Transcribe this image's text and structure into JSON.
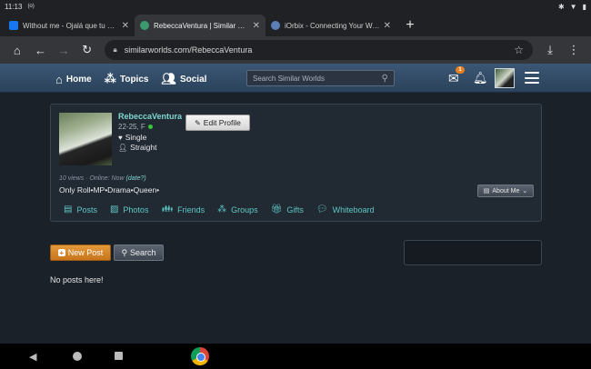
{
  "status_bar": {
    "time": "11:13",
    "extra": "(o)"
  },
  "tabs": [
    {
      "title": "Without me - Ojalá que tu vida esté llena de éxito",
      "favicon_color": "#1877f2",
      "active": false
    },
    {
      "title": "RebeccaVentura | Similar Worlds",
      "favicon_color": "#3d9a6e",
      "active": true
    },
    {
      "title": "iOrbix - Connecting Your World",
      "favicon_color": "#5a7fb5",
      "active": false
    }
  ],
  "address_bar": {
    "url": "similarworlds.com/RebeccaVentura"
  },
  "site_nav": {
    "home": "Home",
    "topics": "Topics",
    "social": "Social",
    "search_placeholder": "Search Similar Worlds",
    "mail_badge": "1"
  },
  "profile": {
    "username": "RebeccaVentura",
    "age_gender": "22-25, F",
    "relationship": "Single",
    "orientation": "Straight",
    "edit_label": "Edit Profile",
    "views_text": "10 views · Online: Now",
    "date_link": "(date?)",
    "bio": "Only Roll•MP•Drama•Queen•",
    "about_label": "About Me",
    "tabs": [
      "Posts",
      "Photos",
      "Friends",
      "Groups",
      "Gifts",
      "Whiteboard"
    ]
  },
  "actions": {
    "new_post": "New Post",
    "search": "Search"
  },
  "empty_message": "No posts here!"
}
